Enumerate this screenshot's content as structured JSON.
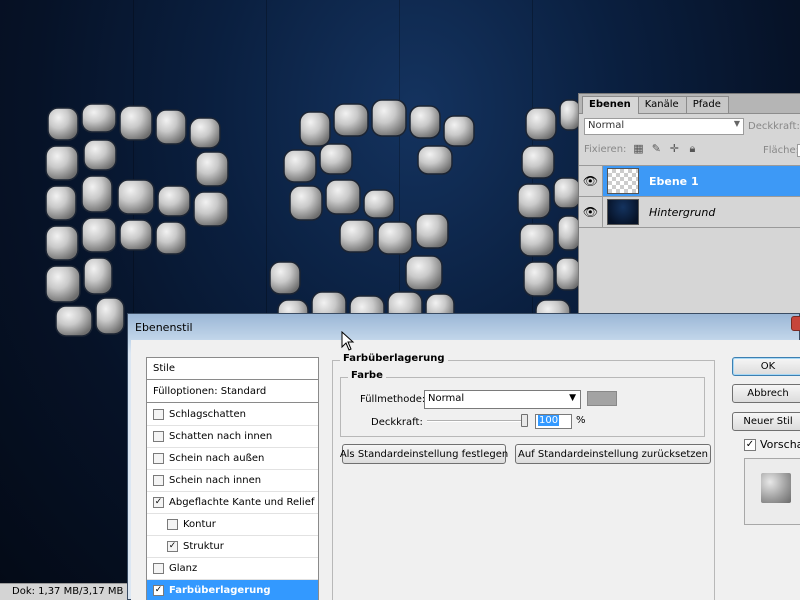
{
  "status_bar": {
    "doc_info": "Dok: 1,37 MB/3,17 MB"
  },
  "layers_panel": {
    "tabs": [
      "Ebenen",
      "Kanäle",
      "Pfade"
    ],
    "blend_mode": "Normal",
    "opacity_label": "Deckkraft:",
    "lock_label": "Fixieren:",
    "fill_label": "Fläche:",
    "layers": [
      {
        "name": "Ebene 1",
        "selected": true,
        "visible": true
      },
      {
        "name": "Hintergrund",
        "selected": false,
        "visible": true
      }
    ]
  },
  "dialog": {
    "title": "Ebenenstil",
    "styles_list": {
      "header": "Stile",
      "blend_options": "Fülloptionen: Standard",
      "items": [
        {
          "label": "Schlagschatten",
          "checked": false,
          "indent": false
        },
        {
          "label": "Schatten nach innen",
          "checked": false,
          "indent": false
        },
        {
          "label": "Schein nach außen",
          "checked": false,
          "indent": false
        },
        {
          "label": "Schein nach innen",
          "checked": false,
          "indent": false
        },
        {
          "label": "Abgeflachte Kante und Relief",
          "checked": true,
          "indent": false
        },
        {
          "label": "Kontur",
          "checked": false,
          "indent": true
        },
        {
          "label": "Struktur",
          "checked": true,
          "indent": true
        },
        {
          "label": "Glanz",
          "checked": false,
          "indent": false
        },
        {
          "label": "Farbüberlagerung",
          "checked": true,
          "indent": false,
          "selected": true
        }
      ]
    },
    "section_title": "Farbüberlagerung",
    "subsection_title": "Farbe",
    "fill_method_label": "Füllmethode:",
    "fill_method_value": "Normal",
    "overlay_color": "#a3a3a3",
    "opacity_label": "Deckkraft:",
    "opacity_value": "100",
    "opacity_unit": "%",
    "btn_set_default": "Als Standardeinstellung festlegen",
    "btn_reset_default": "Auf Standardeinstellung zurücksetzen",
    "btn_ok": "OK",
    "btn_cancel": "Abbrech",
    "btn_new_style": "Neuer Stil",
    "preview_label": "Vorscha",
    "preview_checked": true
  },
  "colors": {
    "selection_blue": "#3399ff",
    "layer_selected": "#3d99f6",
    "canvas_bg": "#0a1f3f"
  }
}
